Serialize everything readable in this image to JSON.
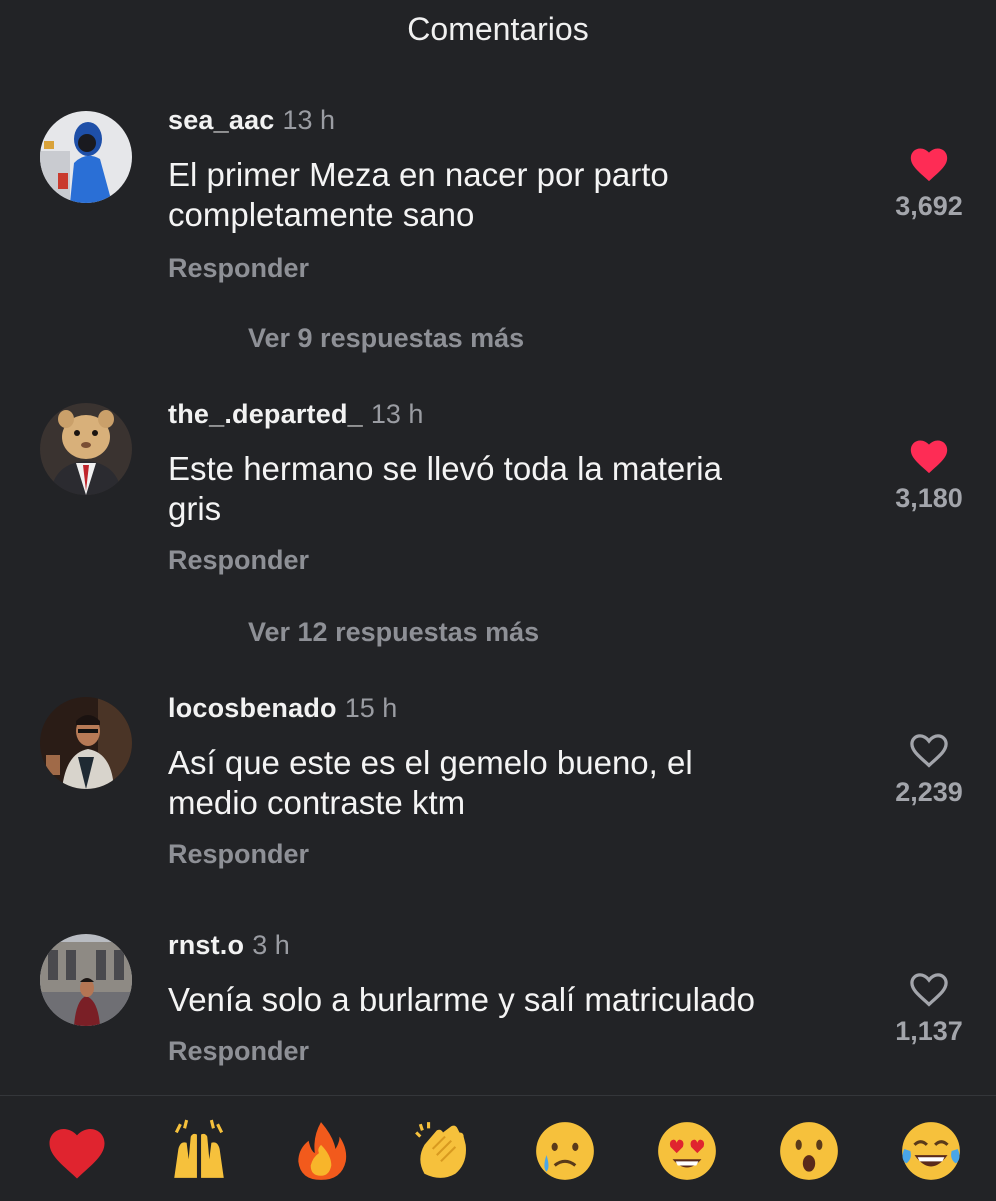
{
  "header": {
    "title": "Comentarios"
  },
  "comments": [
    {
      "username": "sea_aac",
      "time": "13 h",
      "text_line1": "El primer Meza en nacer por parto",
      "text_line2": "completamente sano",
      "reply": "Responder",
      "likes": "3,692",
      "liked": true,
      "more_replies": "Ver 9 respuestas más"
    },
    {
      "username": "the_.departed_",
      "time": "13 h",
      "text_line1": "Este hermano se llevó toda la materia",
      "text_line2": "gris",
      "reply": "Responder",
      "likes": "3,180",
      "liked": true,
      "more_replies": "Ver 12 respuestas más"
    },
    {
      "username": "locosbenado",
      "time": "15 h",
      "text_line1": "Así que este es el gemelo bueno, el",
      "text_line2": "medio contraste ktm",
      "reply": "Responder",
      "likes": "2,239",
      "liked": false
    },
    {
      "username": "rnst.o",
      "time": "3 h",
      "text_line1": "Venía solo a burlarme y salí matriculado",
      "reply": "Responder",
      "likes": "1,137",
      "liked": false
    }
  ],
  "emoji_bar": [
    "red-heart",
    "raising-hands",
    "fire",
    "clapping-hands",
    "sad-face",
    "heart-eyes",
    "surprised-face",
    "tears-of-joy"
  ],
  "colors": {
    "background": "#222326",
    "liked_heart": "#fe2c55",
    "muted_text": "#8e9096"
  }
}
